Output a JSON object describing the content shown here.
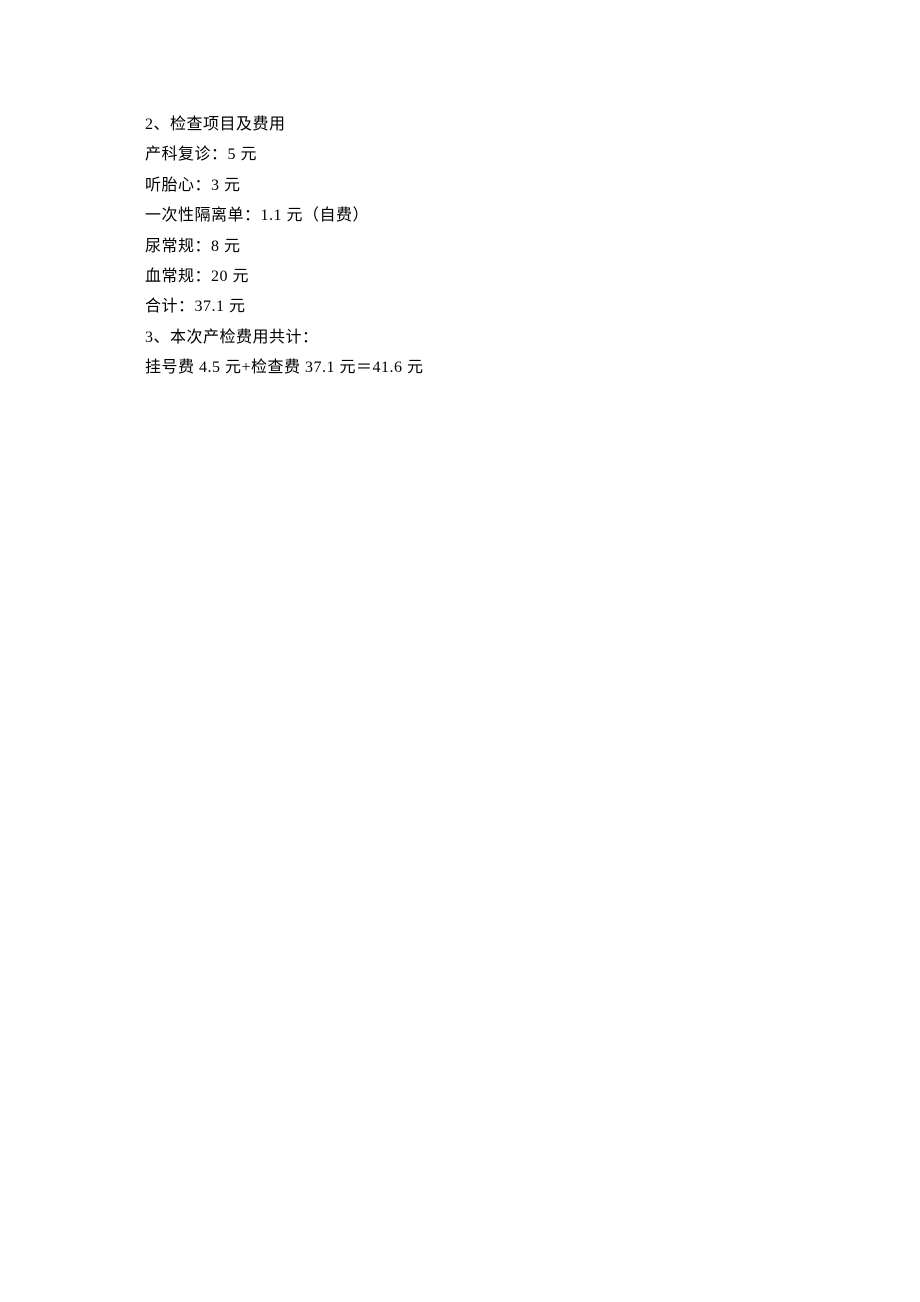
{
  "lines": [
    "2、检查项目及费用",
    "产科复诊：5 元",
    "听胎心：3 元",
    "一次性隔离单：1.1 元（自费）",
    "尿常规：8 元",
    "血常规：20 元",
    "合计：37.1 元",
    "3、本次产检费用共计：",
    "挂号费 4.5 元+检查费 37.1 元＝41.6 元"
  ]
}
